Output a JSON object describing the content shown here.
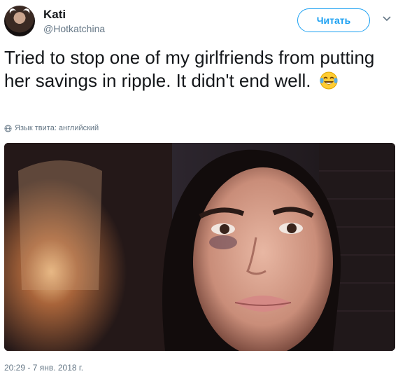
{
  "user": {
    "name": "Kati",
    "handle": "@Hotkatchina"
  },
  "header": {
    "follow_label": "Читать"
  },
  "tweet": {
    "text": "Tried to stop one of my girlfriends from putting her savings in ripple. It didn't end well.",
    "emoji": "face-with-tears-of-joy",
    "language_note": "Язык твита: английский",
    "timestamp": "20:29 - 7 янв. 2018 г."
  },
  "colors": {
    "accent": "#1da1f2",
    "secondary_text": "#657786",
    "primary_text": "#14171a"
  },
  "icons": {
    "more_menu": "chevron-down-icon",
    "language": "globe-icon"
  }
}
